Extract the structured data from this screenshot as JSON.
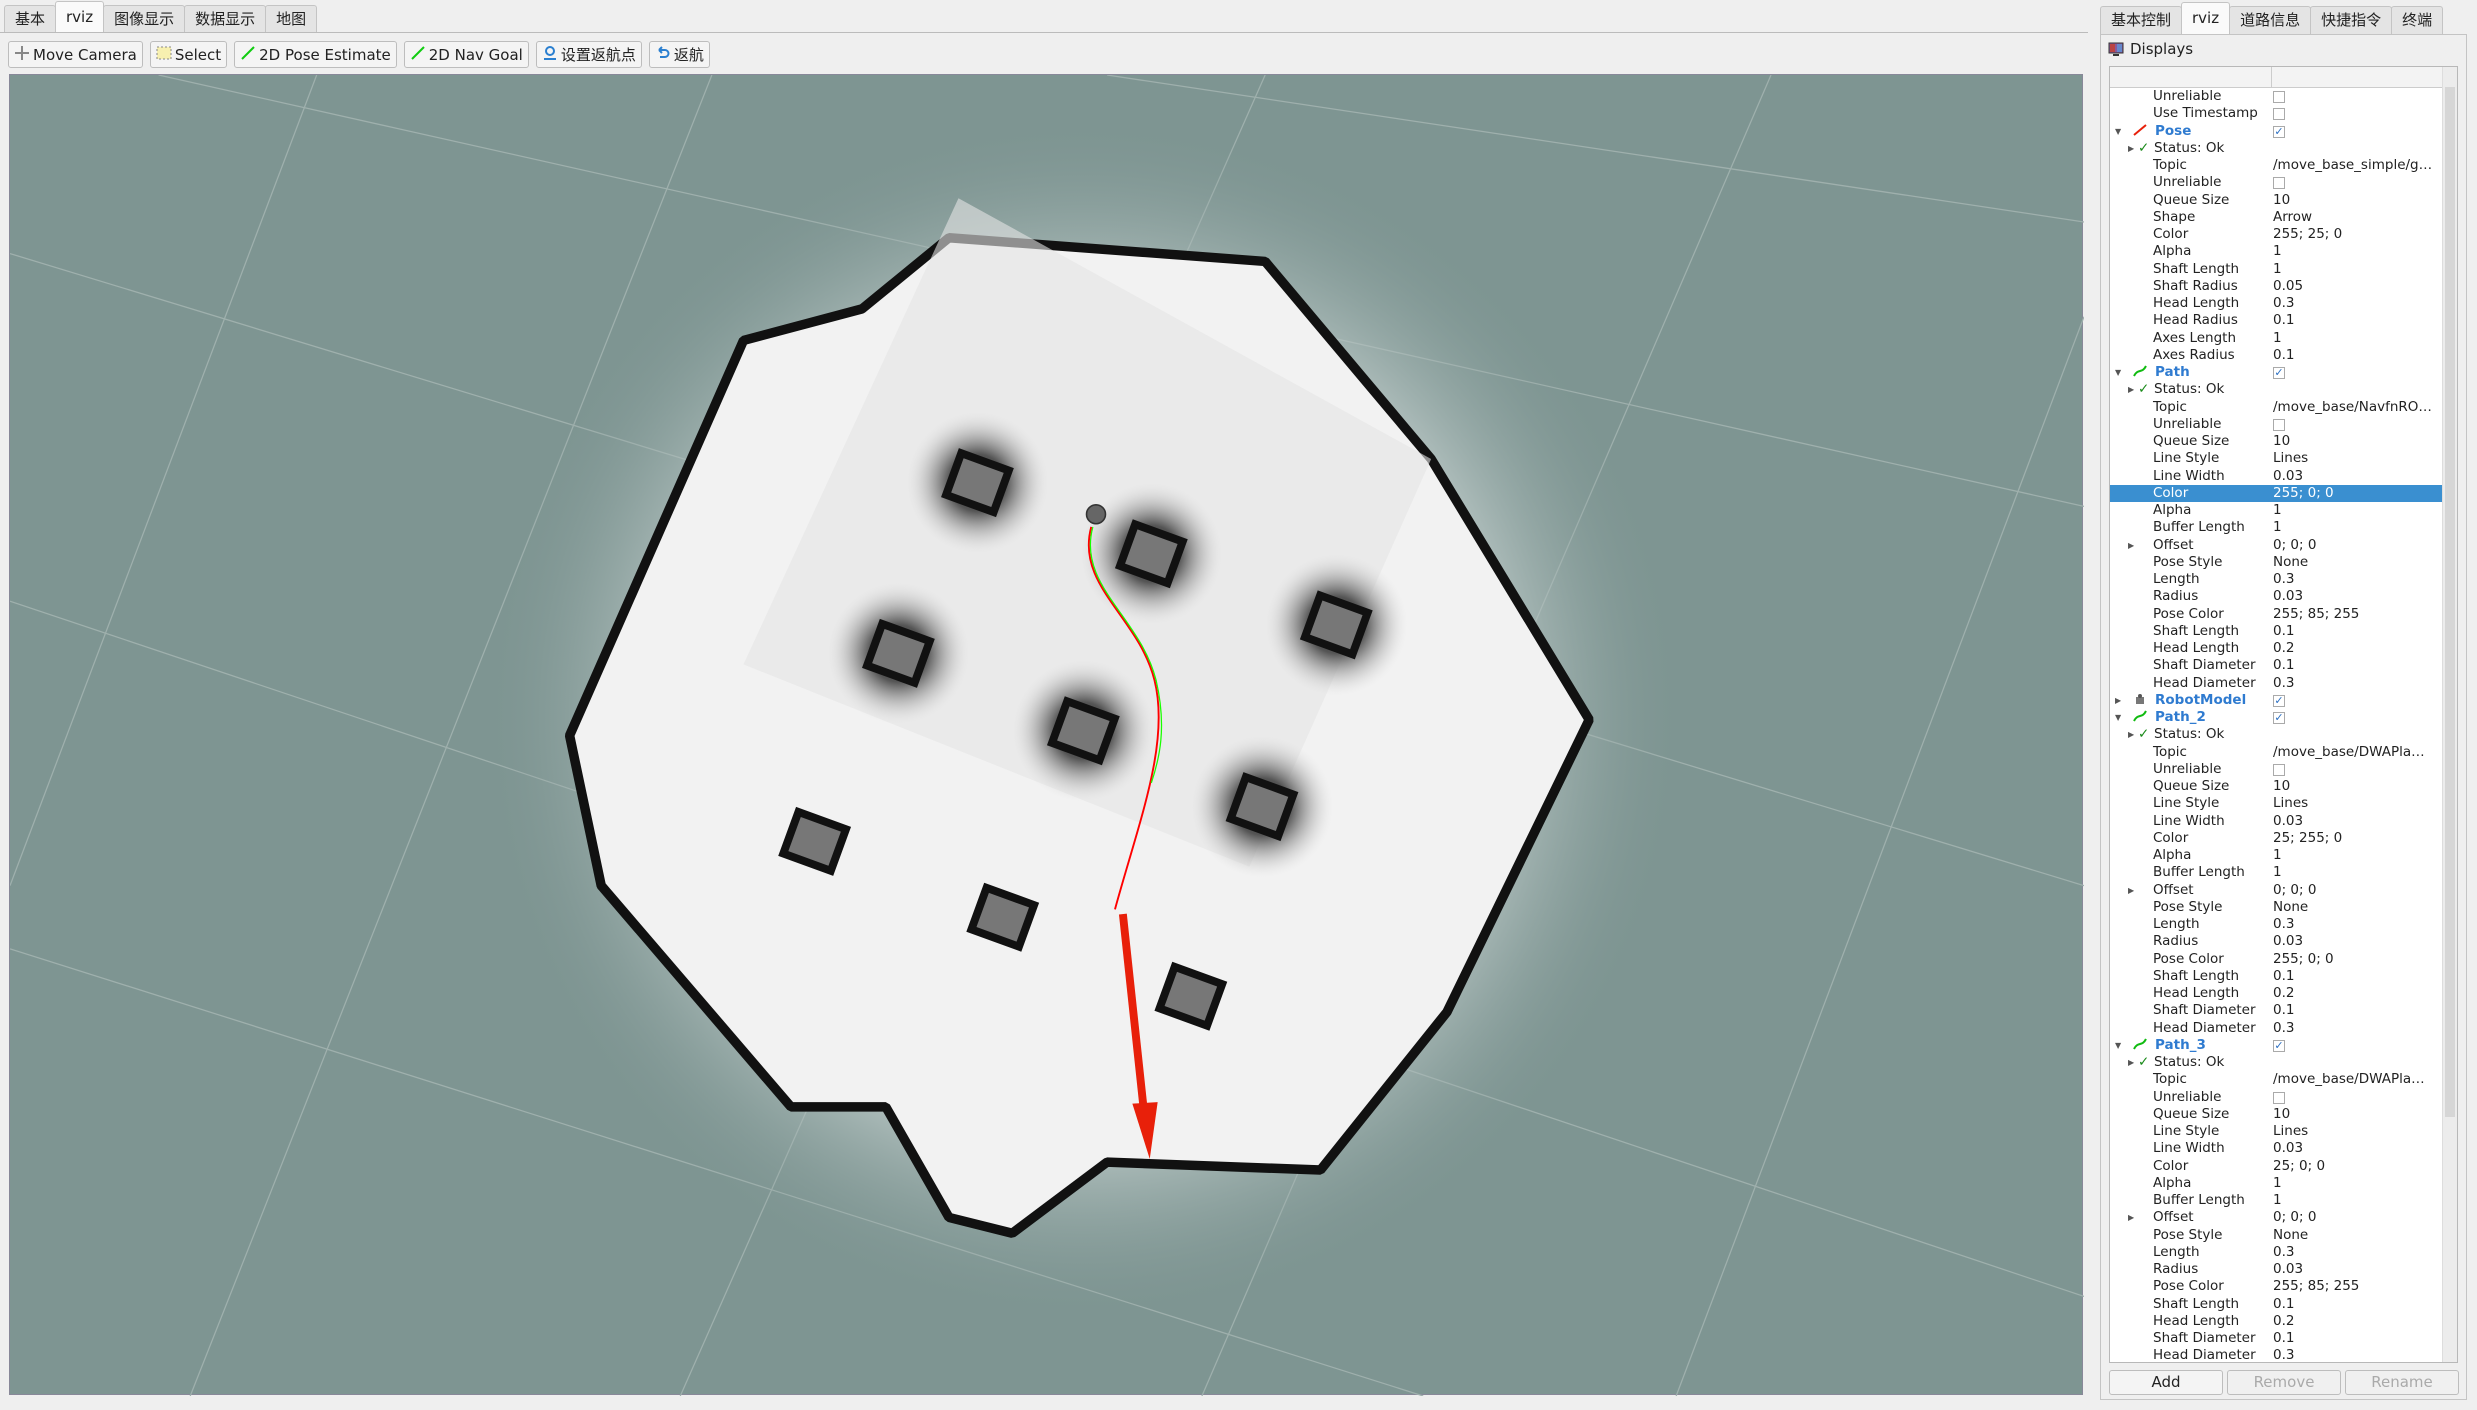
{
  "left_tabs": [
    "基本",
    "rviz",
    "图像显示",
    "数据显示",
    "地图"
  ],
  "left_active": 1,
  "toolbar": [
    {
      "label": "Move Camera",
      "icon": "move-camera-icon"
    },
    {
      "label": "Select",
      "icon": "select-icon"
    },
    {
      "label": "2D Pose Estimate",
      "icon": "pose-estimate-arrow-icon"
    },
    {
      "label": "2D Nav Goal",
      "icon": "nav-goal-arrow-icon"
    },
    {
      "label": "设置返航点",
      "icon": "location-pin-icon"
    },
    {
      "label": "返航",
      "icon": "return-arrow-icon"
    }
  ],
  "right_tabs": [
    "基本控制",
    "rviz",
    "道路信息",
    "快捷指令",
    "终端"
  ],
  "right_active": 1,
  "displays_title": "Displays",
  "colors": {
    "selection": "#3a8fd0",
    "group_label": "#2f7bd0",
    "pose_arrow": "#e8200a",
    "path_line": "#ff0000",
    "path_2_line": "#19ff00",
    "map_background": "#7e9592"
  },
  "tree": [
    {
      "k": "Unreliable",
      "cb": false
    },
    {
      "k": "Use Timestamp",
      "cb": false
    },
    {
      "k": "Pose",
      "group": true,
      "cb": true,
      "icon": "pose-arrow-icon"
    },
    {
      "k": "Status: Ok",
      "status": true
    },
    {
      "k": "Topic",
      "v": "/move_base_simple/g…"
    },
    {
      "k": "Unreliable",
      "cb": false
    },
    {
      "k": "Queue Size",
      "v": "10"
    },
    {
      "k": "Shape",
      "v": "Arrow"
    },
    {
      "k": "Color",
      "v": "255; 25; 0"
    },
    {
      "k": "Alpha",
      "v": "1"
    },
    {
      "k": "Shaft Length",
      "v": "1"
    },
    {
      "k": "Shaft Radius",
      "v": "0.05"
    },
    {
      "k": "Head Length",
      "v": "0.3"
    },
    {
      "k": "Head Radius",
      "v": "0.1"
    },
    {
      "k": "Axes Length",
      "v": "1"
    },
    {
      "k": "Axes Radius",
      "v": "0.1"
    },
    {
      "k": "Path",
      "group": true,
      "cb": true,
      "icon": "path-icon"
    },
    {
      "k": "Status: Ok",
      "status": true
    },
    {
      "k": "Topic",
      "v": "/move_base/NavfnRO…"
    },
    {
      "k": "Unreliable",
      "cb": false
    },
    {
      "k": "Queue Size",
      "v": "10"
    },
    {
      "k": "Line Style",
      "v": "Lines"
    },
    {
      "k": "Line Width",
      "v": "0.03"
    },
    {
      "k": "Color",
      "v": "255; 0; 0",
      "selected": true
    },
    {
      "k": "Alpha",
      "v": "1"
    },
    {
      "k": "Buffer Length",
      "v": "1"
    },
    {
      "k": "Offset",
      "v": "0; 0; 0",
      "expandable": true
    },
    {
      "k": "Pose Style",
      "v": "None"
    },
    {
      "k": "Length",
      "v": "0.3"
    },
    {
      "k": "Radius",
      "v": "0.03"
    },
    {
      "k": "Pose Color",
      "v": "255; 85; 255"
    },
    {
      "k": "Shaft Length",
      "v": "0.1"
    },
    {
      "k": "Head Length",
      "v": "0.2"
    },
    {
      "k": "Shaft Diameter",
      "v": "0.1"
    },
    {
      "k": "Head Diameter",
      "v": "0.3"
    },
    {
      "k": "RobotModel",
      "group": true,
      "collapsed": true,
      "cb": true,
      "icon": "robot-model-icon"
    },
    {
      "k": "Path_2",
      "group": true,
      "cb": true,
      "icon": "path-icon"
    },
    {
      "k": "Status: Ok",
      "status": true
    },
    {
      "k": "Topic",
      "v": "/move_base/DWAPla…"
    },
    {
      "k": "Unreliable",
      "cb": false
    },
    {
      "k": "Queue Size",
      "v": "10"
    },
    {
      "k": "Line Style",
      "v": "Lines"
    },
    {
      "k": "Line Width",
      "v": "0.03"
    },
    {
      "k": "Color",
      "v": "25; 255; 0"
    },
    {
      "k": "Alpha",
      "v": "1"
    },
    {
      "k": "Buffer Length",
      "v": "1"
    },
    {
      "k": "Offset",
      "v": "0; 0; 0",
      "expandable": true
    },
    {
      "k": "Pose Style",
      "v": "None"
    },
    {
      "k": "Length",
      "v": "0.3"
    },
    {
      "k": "Radius",
      "v": "0.03"
    },
    {
      "k": "Pose Color",
      "v": "255; 0; 0"
    },
    {
      "k": "Shaft Length",
      "v": "0.1"
    },
    {
      "k": "Head Length",
      "v": "0.2"
    },
    {
      "k": "Shaft Diameter",
      "v": "0.1"
    },
    {
      "k": "Head Diameter",
      "v": "0.3"
    },
    {
      "k": "Path_3",
      "group": true,
      "cb": true,
      "icon": "path-icon"
    },
    {
      "k": "Status: Ok",
      "status": true
    },
    {
      "k": "Topic",
      "v": "/move_base/DWAPla…"
    },
    {
      "k": "Unreliable",
      "cb": false
    },
    {
      "k": "Queue Size",
      "v": "10"
    },
    {
      "k": "Line Style",
      "v": "Lines"
    },
    {
      "k": "Line Width",
      "v": "0.03"
    },
    {
      "k": "Color",
      "v": "25; 0; 0"
    },
    {
      "k": "Alpha",
      "v": "1"
    },
    {
      "k": "Buffer Length",
      "v": "1"
    },
    {
      "k": "Offset",
      "v": "0; 0; 0",
      "expandable": true
    },
    {
      "k": "Pose Style",
      "v": "None"
    },
    {
      "k": "Length",
      "v": "0.3"
    },
    {
      "k": "Radius",
      "v": "0.03"
    },
    {
      "k": "Pose Color",
      "v": "255; 85; 255"
    },
    {
      "k": "Shaft Length",
      "v": "0.1"
    },
    {
      "k": "Head Length",
      "v": "0.2"
    },
    {
      "k": "Shaft Diameter",
      "v": "0.1"
    },
    {
      "k": "Head Diameter",
      "v": "0.3"
    }
  ],
  "buttons": {
    "add": "Add",
    "remove": "Remove",
    "rename": "Rename"
  }
}
